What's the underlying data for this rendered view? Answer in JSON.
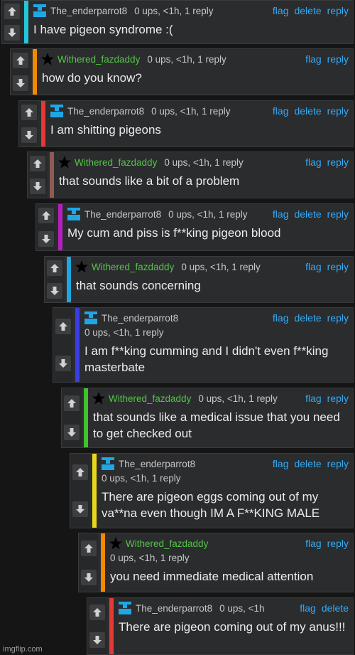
{
  "comments": [
    {
      "user": "The_enderparrot8",
      "badge": "mod-icon",
      "stats": "0 ups, <1h, 1 reply",
      "stats_inline": true,
      "actions": [
        "flag",
        "delete",
        "reply"
      ],
      "text": "I have pigeon syndrome :(",
      "color": "#26c6da",
      "name_color": "#c8c8c8"
    },
    {
      "user": "Withered_fazdaddy",
      "badge": "star-icon",
      "stats": "0 ups, <1h, 1 reply",
      "stats_inline": true,
      "actions": [
        "flag",
        "reply"
      ],
      "text": "how do you know?",
      "color": "#f08a00",
      "name_color": "#55c34a"
    },
    {
      "user": "The_enderparrot8",
      "badge": "mod-icon",
      "stats": "0 ups, <1h, 1 reply",
      "stats_inline": true,
      "actions": [
        "flag",
        "delete",
        "reply"
      ],
      "text": "I am shitting pigeons",
      "color": "#e53935",
      "name_color": "#c8c8c8"
    },
    {
      "user": "Withered_fazdaddy",
      "badge": "star-icon",
      "stats": "0 ups, <1h, 1 reply",
      "stats_inline": true,
      "actions": [
        "flag",
        "reply"
      ],
      "text": "that sounds like a bit of a problem",
      "color": "#8d5a55",
      "name_color": "#55c34a"
    },
    {
      "user": "The_enderparrot8",
      "badge": "mod-icon",
      "stats": "0 ups, <1h, 1 reply",
      "stats_inline": true,
      "actions": [
        "flag",
        "delete",
        "reply"
      ],
      "text": "My cum and piss is f**king pigeon blood",
      "color": "#b51fbf",
      "name_color": "#c8c8c8"
    },
    {
      "user": "Withered_fazdaddy",
      "badge": "star-icon",
      "stats": "0 ups, <1h, 1 reply",
      "stats_inline": true,
      "actions": [
        "flag",
        "reply"
      ],
      "text": "that sounds concerning",
      "color": "#1ea7e0",
      "name_color": "#55c34a"
    },
    {
      "user": "The_enderparrot8",
      "badge": "mod-icon",
      "stats": "0 ups, <1h, 1 reply",
      "stats_inline": false,
      "actions": [
        "flag",
        "delete",
        "reply"
      ],
      "text": "I am f**king cumming and I didn't even f**king masterbate",
      "color": "#3a3ee6",
      "name_color": "#c8c8c8"
    },
    {
      "user": "Withered_fazdaddy",
      "badge": "star-icon",
      "stats": "0 ups, <1h, 1 reply",
      "stats_inline": true,
      "actions": [
        "flag",
        "reply"
      ],
      "text": "that sounds like a medical issue that you need to get checked out",
      "color": "#3fc22b",
      "name_color": "#55c34a"
    },
    {
      "user": "The_enderparrot8",
      "badge": "mod-icon",
      "stats": "0 ups, <1h, 1 reply",
      "stats_inline": false,
      "actions": [
        "flag",
        "delete",
        "reply"
      ],
      "text": "There are pigeon eggs coming out of my va**na even though IM A F**KING MALE",
      "color": "#e8d81c",
      "name_color": "#c8c8c8"
    },
    {
      "user": "Withered_fazdaddy",
      "badge": "star-icon",
      "stats": "0 ups, <1h, 1 reply",
      "stats_inline": false,
      "actions": [
        "flag",
        "reply"
      ],
      "text": "you need immediate medical attention",
      "color": "#f08a00",
      "name_color": "#55c34a"
    },
    {
      "user": "The_enderparrot8",
      "badge": "mod-icon",
      "stats": "0 ups, <1h",
      "stats_inline": true,
      "actions": [
        "flag",
        "delete"
      ],
      "text": "There are pigeon coming out of my anus!!!",
      "color": "#e53935",
      "name_color": "#c8c8c8"
    }
  ],
  "watermark": "imgflip.com"
}
